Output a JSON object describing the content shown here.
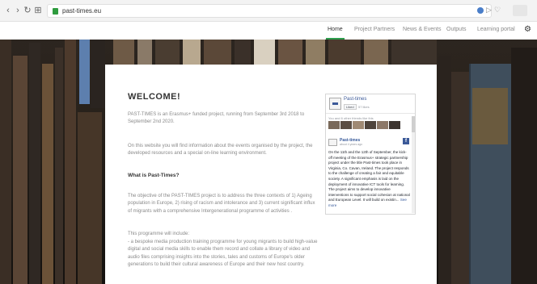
{
  "browser": {
    "url": "past-times.eu"
  },
  "site_nav": {
    "items": [
      "Home",
      "Project Partners",
      "News & Events",
      "Outputs",
      "Learning portal"
    ],
    "active": "Home"
  },
  "content": {
    "title": "WELCOME!",
    "intro": "PAST-TIMES is an Erasmus+ funded project, running from September 3rd 2018 to September 2nd 2020.",
    "info": "On this website you will find information about the events organised by the project, the developed resources and a special on-line learning environment.",
    "subheading": "What is Past-Times?",
    "objective": "The objective of the PAST-TIMES project is to address the three contexts of 1) Ageing population in Europe, 2) rising of racism and intolerance and 3) current significant influx of migrants with a comprehensive Intergenerational programme of activities .",
    "programme_intro": "This programme will include:",
    "programme_item": "- a bespoke media production training programme for young migrants to build high-value digital and social media skills to enable them record and collate a library of video and audio files comprising insights into the stories, tales and customs of Europe's older generations to build their cultural awareness of Europe and their new host country."
  },
  "facebook_widget": {
    "page_name": "Past-times",
    "like_label": "Liked",
    "likes_count": "57 likes",
    "friends_text": "You and 6 other friends like this",
    "post_author": "Past-times",
    "post_sub": "about 4 years ago",
    "post_text": "On the 11th and the 12th of September, the kick-off meeting of the Erasmus+ strategic partnership project under the title Past-times took place in Virginia, Co. Cavan, Ireland. The project responds to the challenge of creating a fair and equitable society. A significant emphasis is laid on the deployment of innovative ICT tools for learning. The project aims to develop innovative interventions to support social cohesion at national and European Level. It will build on existin...",
    "see_more": "See more"
  },
  "colors": {
    "accent": "#2d9e4d",
    "facebook_blue": "#3b5998"
  },
  "icons": [
    "back-icon",
    "forward-icon",
    "reload-icon",
    "home-icon",
    "lock-icon",
    "settings-gear-icon"
  ]
}
